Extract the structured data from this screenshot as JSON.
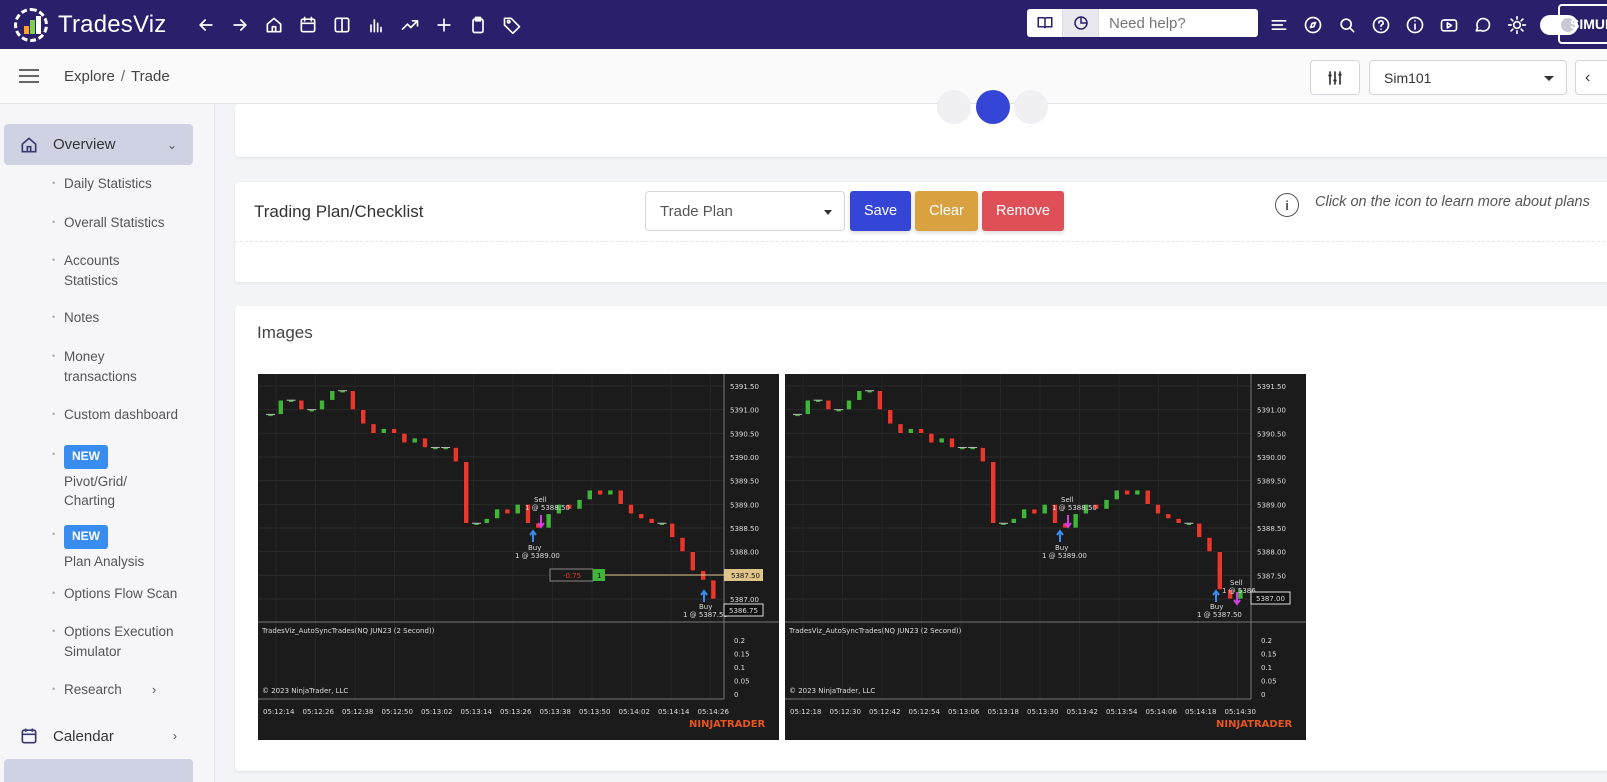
{
  "app": {
    "name": "TradesViz",
    "help_placeholder": "Need help?",
    "sim_label": "SIMULA"
  },
  "nav_icons": [
    "back-arrow-icon",
    "forward-arrow-icon",
    "home-icon",
    "calendar-icon",
    "columns-icon",
    "bar-chart-icon",
    "trend-icon",
    "plus-icon",
    "clipboard-icon",
    "tag-icon"
  ],
  "right_icons": [
    "sliders-icon",
    "compass-icon",
    "search-icon",
    "question-icon",
    "info-icon",
    "video-icon",
    "chat-icon",
    "sun-icon"
  ],
  "breadcrumb": {
    "root": "Explore",
    "separator": "/",
    "current": "Trade"
  },
  "account": {
    "selected": "Sim101"
  },
  "sidebar": {
    "overview_label": "Overview",
    "items": [
      {
        "label": "Daily Statistics"
      },
      {
        "label": "Overall Statistics"
      },
      {
        "label": "Accounts Statistics"
      },
      {
        "label": "Notes"
      },
      {
        "label": "Money transactions"
      },
      {
        "label": "Custom dashboard"
      },
      {
        "label": "Pivot/Grid/ Charting",
        "badge": "NEW"
      },
      {
        "label": "Plan Analysis",
        "badge": "NEW"
      },
      {
        "label": "Options Flow Scan"
      },
      {
        "label": "Options Execution Simulator"
      },
      {
        "label": "Research"
      }
    ],
    "calendar_label": "Calendar"
  },
  "plan": {
    "title": "Trading Plan/Checklist",
    "select_value": "Trade Plan",
    "save_label": "Save",
    "clear_label": "Clear",
    "remove_label": "Remove",
    "hint": "Click on the icon to learn more about plans"
  },
  "images": {
    "title": "Images",
    "charts": [
      {
        "price_ticks": [
          "5391.50",
          "5391.00",
          "5390.50",
          "5390.00",
          "5389.50",
          "5389.00",
          "5388.50",
          "5388.00",
          "5387.50",
          "5387.00"
        ],
        "time_ticks": [
          "05:12:14",
          "05:12:26",
          "05:12:38",
          "05:12:50",
          "05:13:02",
          "05:13:14",
          "05:13:26",
          "05:13:38",
          "05:13:50",
          "05:14:02",
          "05:14:14",
          "05:14:26"
        ],
        "indicator_label": "TradesViz_AutoSyncTrades(NQ JUN23 (2 Second))",
        "indicator_ticks": [
          "0.2",
          "0.15",
          "0.1",
          "0.05",
          "0"
        ],
        "copyright": "© 2023 NinjaTrader, LLC",
        "brand": "NINJATRADER",
        "annotations": [
          "Sell",
          "1 @ 5388.50",
          "Buy",
          "1 @ 5389.00",
          "Buy",
          "1 @ 5387.50"
        ],
        "position_pnl": "-0.75",
        "position_qty": "1",
        "price_marker_1": "5387.50",
        "price_marker_2": "5386.75"
      },
      {
        "price_ticks": [
          "5391.50",
          "5391.00",
          "5390.50",
          "5390.00",
          "5389.50",
          "5389.00",
          "5388.50",
          "5388.00",
          "5387.50",
          "5387.00"
        ],
        "time_ticks": [
          "05:12:18",
          "05:12:30",
          "05:12:42",
          "05:12:54",
          "05:13:06",
          "05:13:18",
          "05:13:30",
          "05:13:42",
          "05:13:54",
          "05:14:06",
          "05:14:18",
          "05:14:30"
        ],
        "indicator_label": "TradesViz_AutoSyncTrades(NQ JUN23 (2 Second))",
        "indicator_ticks": [
          "0.2",
          "0.15",
          "0.1",
          "0.05",
          "0"
        ],
        "copyright": "© 2023 NinjaTrader, LLC",
        "brand": "NINJATRADER",
        "annotations": [
          "Sell",
          "1 @ 5388.50",
          "Buy",
          "1 @ 5389.00",
          "Sell",
          "1 @ 5386.",
          "Buy",
          "1 @ 5387.50"
        ],
        "price_marker_1": "5387.00"
      }
    ]
  },
  "colors": {
    "navbar": "#2a1f6b",
    "primary": "#3546d6",
    "warning": "#d9a140",
    "danger": "#df4f58",
    "badge": "#3a8df0",
    "candle_up": "#3fb63a",
    "candle_down": "#e8382d",
    "brand_orange": "#e8541e"
  }
}
